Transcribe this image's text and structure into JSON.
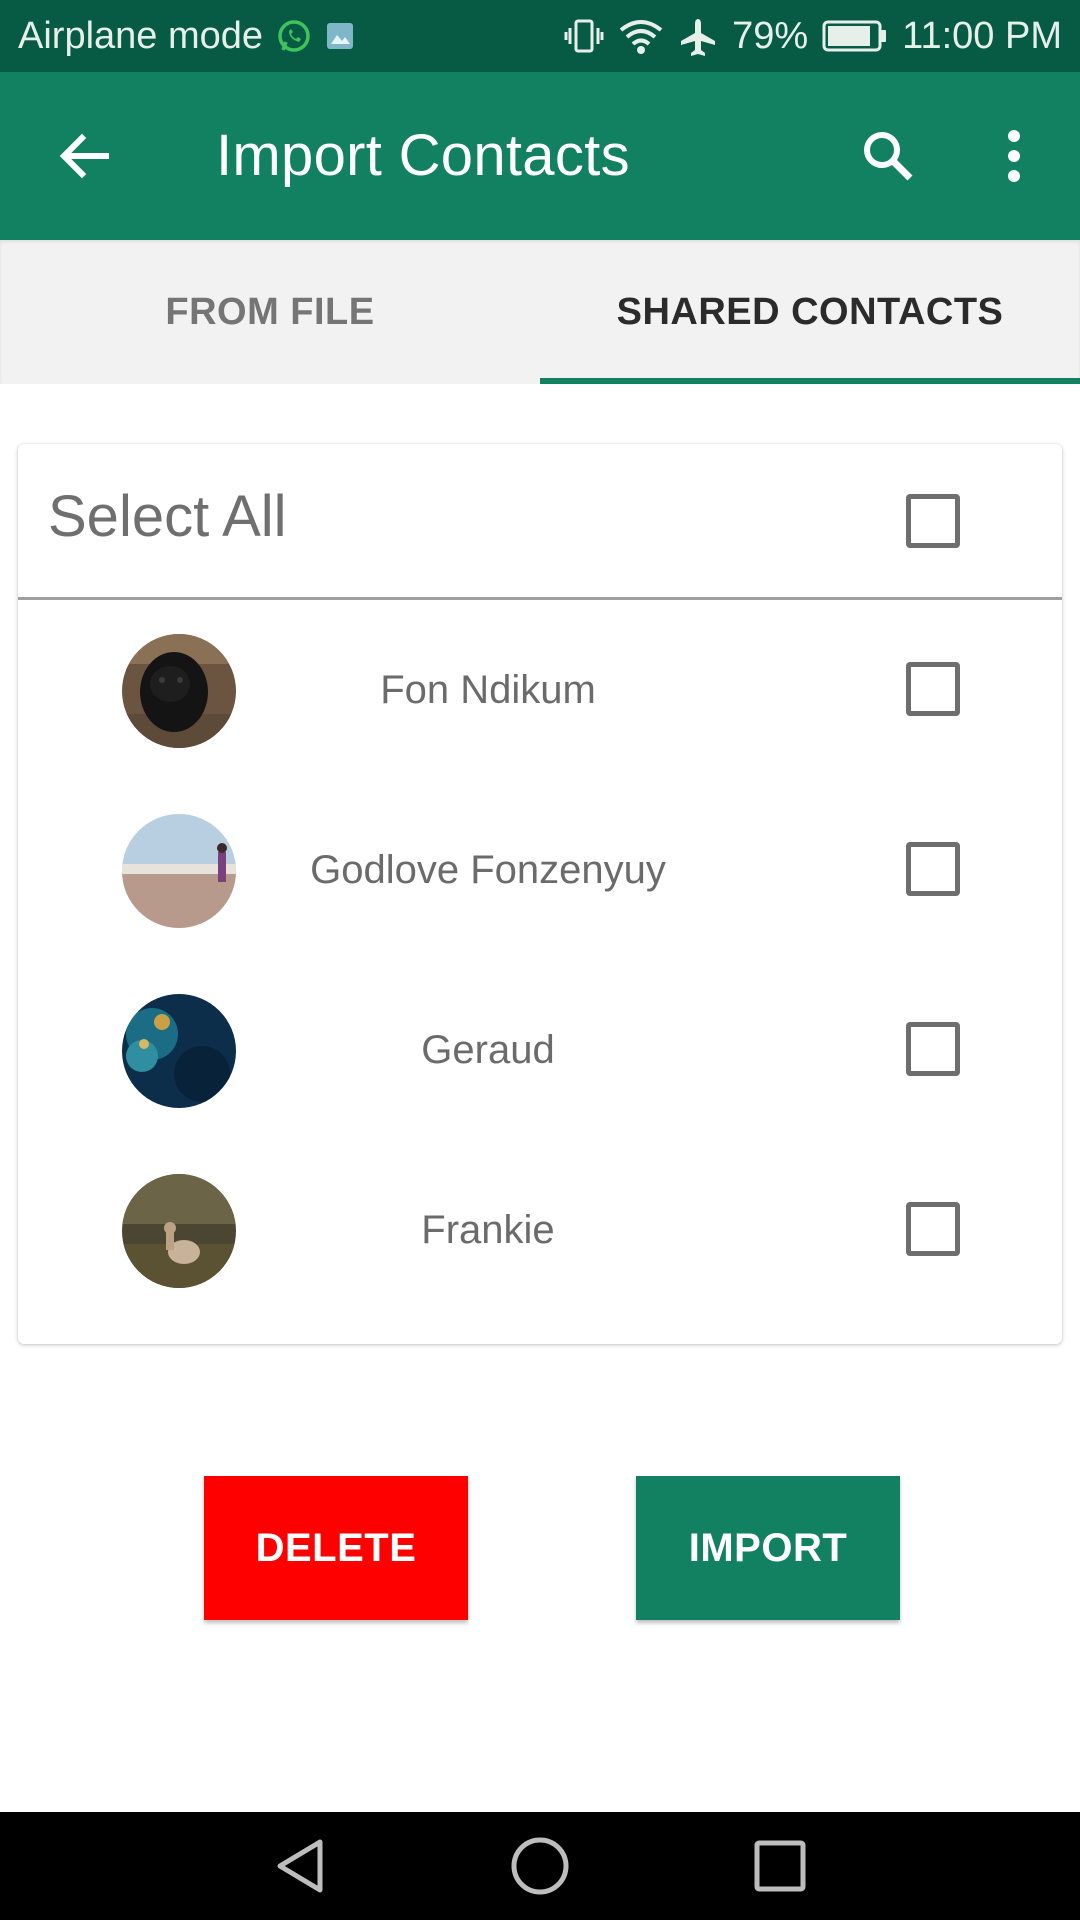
{
  "status_bar": {
    "mode_text": "Airplane mode",
    "battery": "79%",
    "time": "11:00 PM",
    "icons": [
      "whatsapp-icon",
      "gallery-icon",
      "vibrate-icon",
      "wifi-icon",
      "airplane-icon",
      "battery-icon"
    ]
  },
  "app_bar": {
    "title": "Import Contacts",
    "icons": [
      "back-arrow-icon",
      "search-icon",
      "more-vert-icon"
    ]
  },
  "tabs": [
    {
      "label": "FROM FILE",
      "selected": false
    },
    {
      "label": "SHARED CONTACTS",
      "selected": true
    }
  ],
  "select_all": {
    "label": "Select All",
    "checked": false
  },
  "contacts": [
    {
      "name": "Fon Ndikum",
      "checked": false
    },
    {
      "name": "Godlove Fonzenyuy",
      "checked": false
    },
    {
      "name": "Geraud",
      "checked": false
    },
    {
      "name": "Frankie",
      "checked": false
    }
  ],
  "actions": {
    "delete_label": "DELETE",
    "import_label": "IMPORT"
  },
  "colors": {
    "primary": "#128161",
    "status_bar": "#075b45",
    "delete": "#ff0000",
    "tab_indicator": "#128161"
  },
  "nav_bar": {
    "icons": [
      "nav-back-icon",
      "nav-home-icon",
      "nav-recents-icon"
    ]
  }
}
